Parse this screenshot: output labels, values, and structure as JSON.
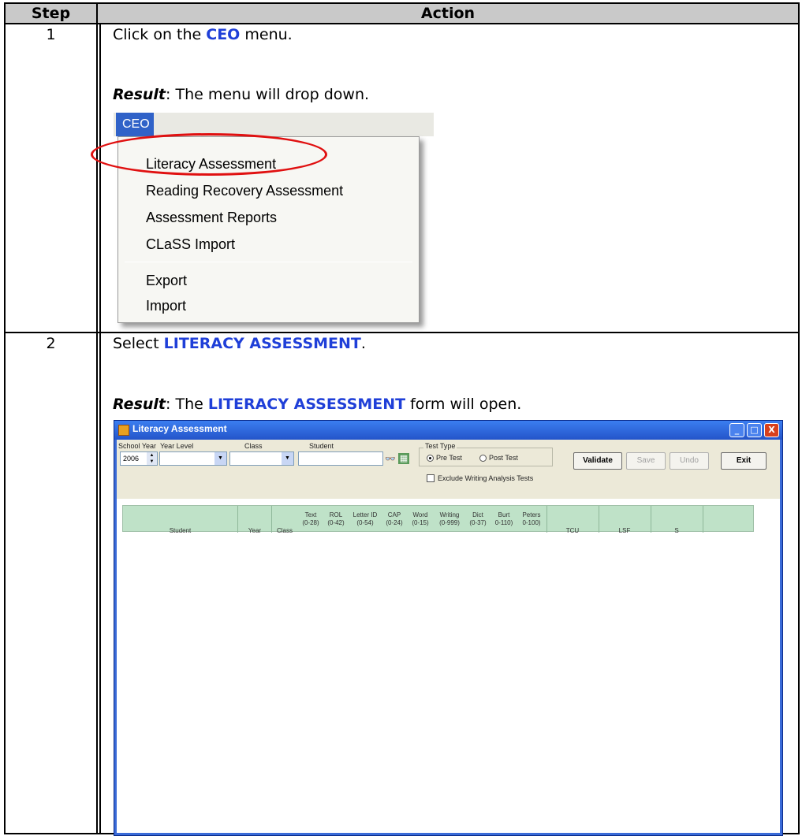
{
  "table": {
    "header": {
      "step": "Step",
      "action": "Action"
    },
    "rows": [
      {
        "step": "1",
        "instruction_pre": "Click on the ",
        "instruction_highlight": "CEO",
        "instruction_post": " menu.",
        "result_label": "Result",
        "result_text": ": The menu will drop down."
      },
      {
        "step": "2",
        "instruction_pre": "Select ",
        "instruction_highlight": "LITERACY ASSESSMENT",
        "instruction_post": ".",
        "result_label": "Result",
        "result_pre": ": The ",
        "result_highlight": "LITERACY ASSESSMENT",
        "result_post": " form will open."
      }
    ]
  },
  "ceo_menu": {
    "menu_title": "CEO",
    "items": [
      "Literacy Assessment",
      "Reading Recovery Assessment",
      "Assessment Reports",
      "CLaSS Import",
      "Export",
      "Import"
    ],
    "highlight_color": "#e01010"
  },
  "literacy_window": {
    "title": "Literacy Assessment",
    "controls": {
      "minimize": "_",
      "maximize": "□",
      "close": "X"
    },
    "school_year_label": "School Year",
    "school_year_value": "2006",
    "year_level_label": "Year Level",
    "class_label": "Class",
    "student_label": "Student",
    "test_type_label": "Test Type",
    "pre_test": "Pre Test",
    "post_test": "Post Test",
    "exclude_label": "Exclude Writing Analysis Tests",
    "buttons": {
      "validate": "Validate",
      "save": "Save",
      "undo": "Undo",
      "exit": "Exit"
    },
    "columns": [
      {
        "line1": "",
        "line2": "Student"
      },
      {
        "line1": "",
        "line2": "Year"
      },
      {
        "line1": "",
        "line2": "Class"
      },
      {
        "line1": "Text",
        "line2": "(0-28)"
      },
      {
        "line1": "ROL",
        "line2": "(0-42)"
      },
      {
        "line1": "Letter ID",
        "line2": "(0-54)"
      },
      {
        "line1": "CAP",
        "line2": "(0-24)"
      },
      {
        "line1": "Word",
        "line2": "(0-15)"
      },
      {
        "line1": "Writing",
        "line2": "(0-999)"
      },
      {
        "line1": "Dict",
        "line2": "(0-37)"
      },
      {
        "line1": "Burt",
        "line2": "0-110)"
      },
      {
        "line1": "Peters",
        "line2": "0-100)"
      },
      {
        "line1": "",
        "line2": "TCU"
      },
      {
        "line1": "",
        "line2": "LSF"
      },
      {
        "line1": "",
        "line2": "S"
      }
    ]
  }
}
